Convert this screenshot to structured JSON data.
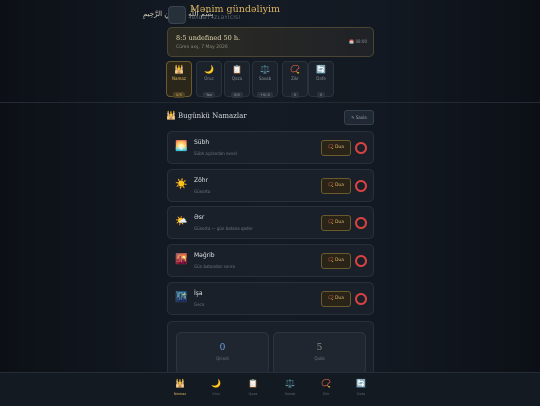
{
  "header": {
    "bismillah": "بِسْمِ اللَّهِ الرَّحْمَٰنِ الرَّحِيمِ",
    "title": "Mənim gündəliyim",
    "subtitle": "İBADƏT İZLƏYİCİSİ"
  },
  "hero": {
    "main": "8:5 undefined 50 h.",
    "date": "Cümə axş, 7 May 2026",
    "badge": "📅 08:00"
  },
  "tabs": [
    {
      "icon": "🕌",
      "label": "Namaz",
      "count": "0/5",
      "active": true
    },
    {
      "icon": "🌙",
      "label": "Oruc",
      "count": "Yox"
    },
    {
      "icon": "📋",
      "label": "Qəza",
      "count": "0/0"
    },
    {
      "icon": "⚖️",
      "label": "Savab",
      "count": "+0/-0"
    },
    {
      "icon": "📿",
      "label": "Zikr",
      "count": "0"
    },
    {
      "icon": "🔄",
      "label": "Dəfə",
      "count": "0"
    }
  ],
  "section": {
    "icon": "🕌",
    "title": "Bugünkü Namazlar",
    "edit_label": "✎ Saxla"
  },
  "prayers": [
    {
      "icon": "🌅",
      "name": "Sübh",
      "desc": "Sübh açılandan əvvəl",
      "dua": "📿 Dua"
    },
    {
      "icon": "☀️",
      "name": "Zöhr",
      "desc": "Günorta",
      "dua": "📿 Dua"
    },
    {
      "icon": "🌤️",
      "name": "Əsr",
      "desc": "Günorta — gün batana qədər",
      "dua": "📿 Dua"
    },
    {
      "icon": "🌇",
      "name": "Məğrib",
      "desc": "Gün batandan sonra",
      "dua": "📿 Dua"
    },
    {
      "icon": "🌃",
      "name": "İşa",
      "desc": "Gecə",
      "dua": "📿 Dua"
    }
  ],
  "stats": [
    {
      "value": "0",
      "label": "Qılındı"
    },
    {
      "value": "5",
      "label": "Qalıb"
    }
  ],
  "bottom_nav": [
    {
      "icon": "🕌",
      "label": "Namaz",
      "active": true
    },
    {
      "icon": "🌙",
      "label": "Oruc"
    },
    {
      "icon": "📋",
      "label": "Qəza"
    },
    {
      "icon": "⚖️",
      "label": "Savab"
    },
    {
      "icon": "📿",
      "label": "Zikr"
    },
    {
      "icon": "🔄",
      "label": "Dəfə"
    }
  ],
  "colors": {
    "accent": "#e0b760",
    "unchecked": "#d9433f",
    "stat_blue": "#6fa3e0"
  }
}
